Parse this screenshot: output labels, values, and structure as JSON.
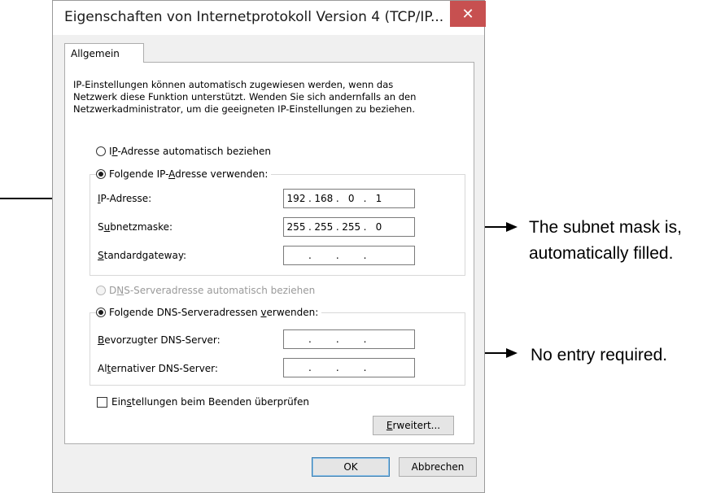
{
  "window": {
    "title": "Eigenschaften von Internetprotokoll Version 4 (TCP/IP...",
    "close_glyph": "✕"
  },
  "tabs": [
    {
      "label": "Allgemein"
    }
  ],
  "description": [
    "IP-Einstellungen können automatisch zugewiesen werden, wenn das",
    "Netzwerk diese Funktion unterstützt. Wenden Sie sich andernfalls an den",
    "Netzwerkadministrator, um die geeigneten IP-Einstellungen zu beziehen."
  ],
  "ip_section": {
    "auto_radio": {
      "pre": "I",
      "key": "P",
      "post": "-Adresse automatisch beziehen",
      "checked": false
    },
    "manual_radio": {
      "pre": "Folgende IP-",
      "key": "A",
      "post": "dresse verwenden:",
      "checked": true
    },
    "fields": [
      {
        "pre": "",
        "key": "I",
        "post": "P-Adresse:",
        "octets": [
          "192",
          "168",
          "0",
          "1"
        ]
      },
      {
        "pre": "S",
        "key": "u",
        "post": "bnetzmaske:",
        "octets": [
          "255",
          "255",
          "255",
          "0"
        ]
      },
      {
        "pre": "",
        "key": "S",
        "post": "tandardgateway:",
        "octets": [
          "",
          "",
          "",
          ""
        ]
      }
    ]
  },
  "dns_section": {
    "auto_radio": {
      "pre": "D",
      "key": "N",
      "post": "S-Serveradresse automatisch beziehen",
      "checked": false,
      "disabled": true
    },
    "manual_radio": {
      "pre": "Folgende DNS-Serveradressen ",
      "key": "v",
      "post": "erwenden:",
      "checked": true
    },
    "fields": [
      {
        "pre": "",
        "key": "B",
        "post": "evorzugter DNS-Server:",
        "octets": [
          "",
          "",
          "",
          ""
        ]
      },
      {
        "pre": "Al",
        "key": "t",
        "post": "ernativer DNS-Server:",
        "octets": [
          "",
          "",
          "",
          ""
        ]
      }
    ]
  },
  "validate_checkbox": {
    "pre": "Ein",
    "key": "s",
    "post": "tellungen beim Beenden überprüfen",
    "checked": false
  },
  "buttons": {
    "advanced": {
      "pre": "",
      "key": "E",
      "post": "rweitert..."
    },
    "ok": "OK",
    "cancel": "Abbrechen"
  },
  "annotations": {
    "subnet_note_line1": "The subnet mask is,",
    "subnet_note_line2": "automatically filled.",
    "dns_note": "No entry required."
  },
  "colors": {
    "close_button": "#c75050",
    "dialog_bg": "#f0f0f0",
    "default_button_border": "#3c7fb1"
  }
}
